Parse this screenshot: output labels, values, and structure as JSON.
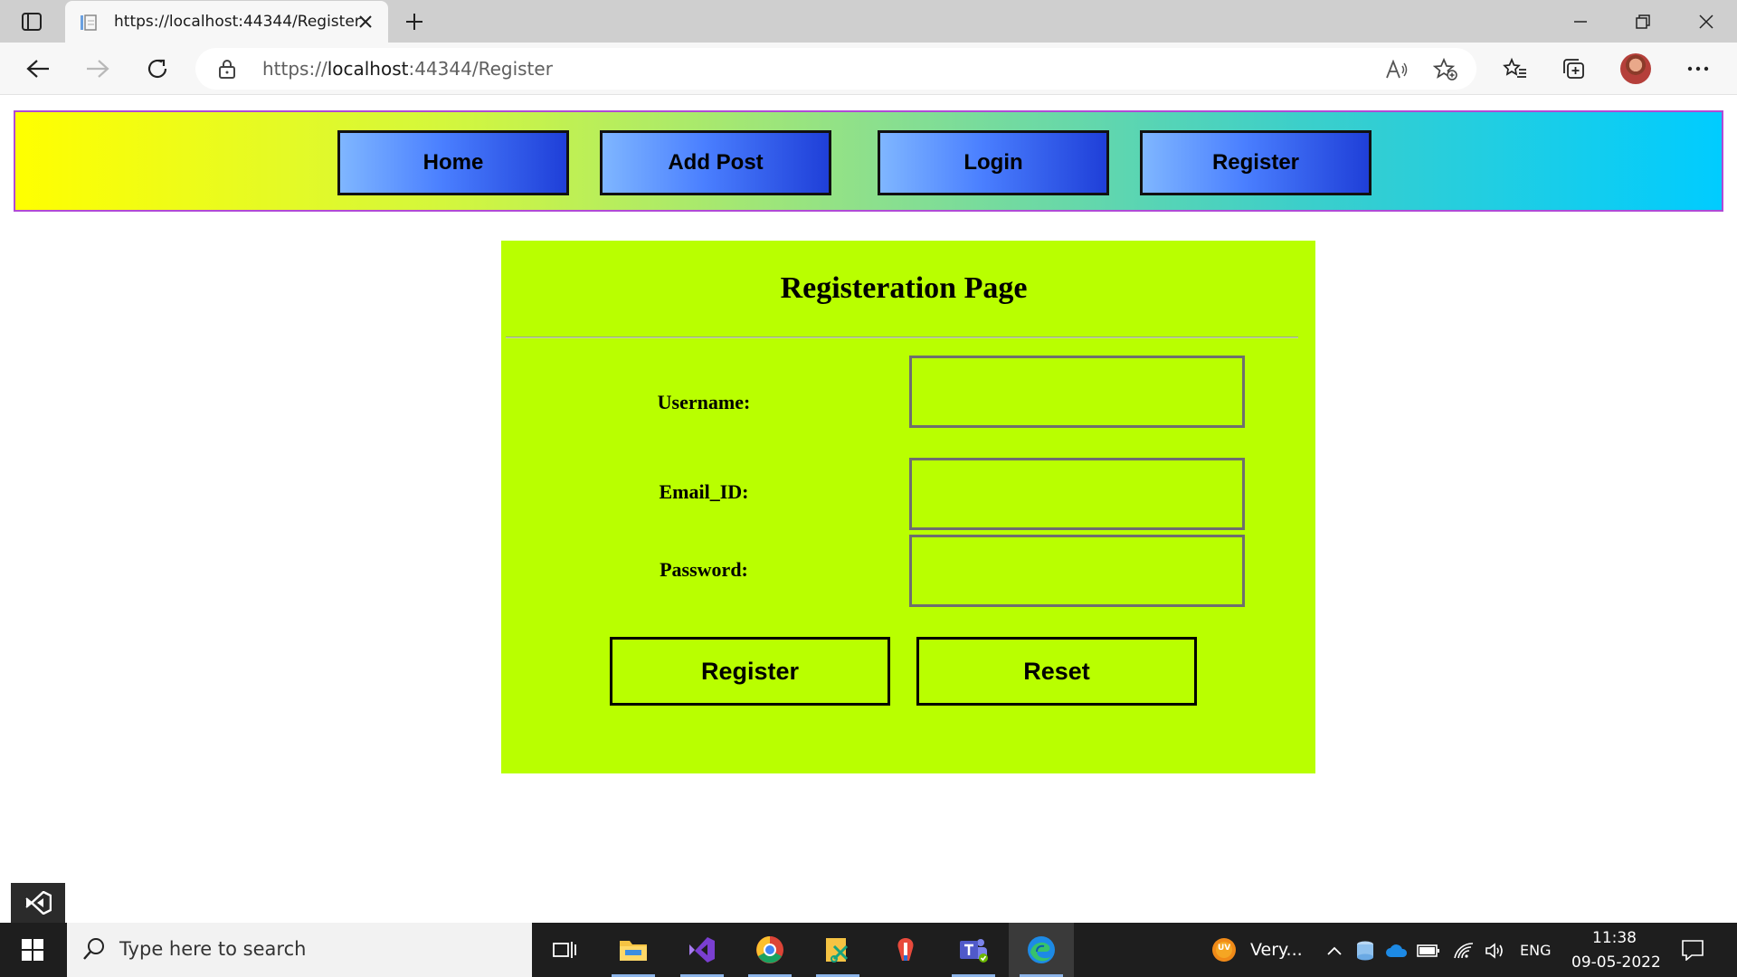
{
  "browser": {
    "tab_title": "https://localhost:44344/Register",
    "url_prefix": "https://",
    "url_host": "localhost",
    "url_path": ":44344/Register"
  },
  "nav": {
    "items": [
      "Home",
      "Add Post",
      "Login",
      "Register"
    ]
  },
  "form": {
    "title": "Registeration Page",
    "username_label": "Username:",
    "email_label": "Email_ID:",
    "password_label": "Password:",
    "username_value": "",
    "email_value": "",
    "password_value": "",
    "register_label": "Register",
    "reset_label": "Reset"
  },
  "colors": {
    "panel": "#b9ff00",
    "nav_gradient_start": "#ffff00",
    "nav_gradient_end": "#00ccff",
    "nav_button": "#4a7fff"
  },
  "taskbar": {
    "search_placeholder": "Type here to search",
    "weather_text": "Very...",
    "weather_badge": "UV",
    "language": "ENG",
    "time": "11:38",
    "date": "09-05-2022",
    "apps": [
      "task-view-icon",
      "file-explorer-icon",
      "visual-studio-icon",
      "chrome-icon",
      "snipping-tool-icon",
      "paint-icon",
      "teams-icon",
      "edge-icon"
    ]
  }
}
